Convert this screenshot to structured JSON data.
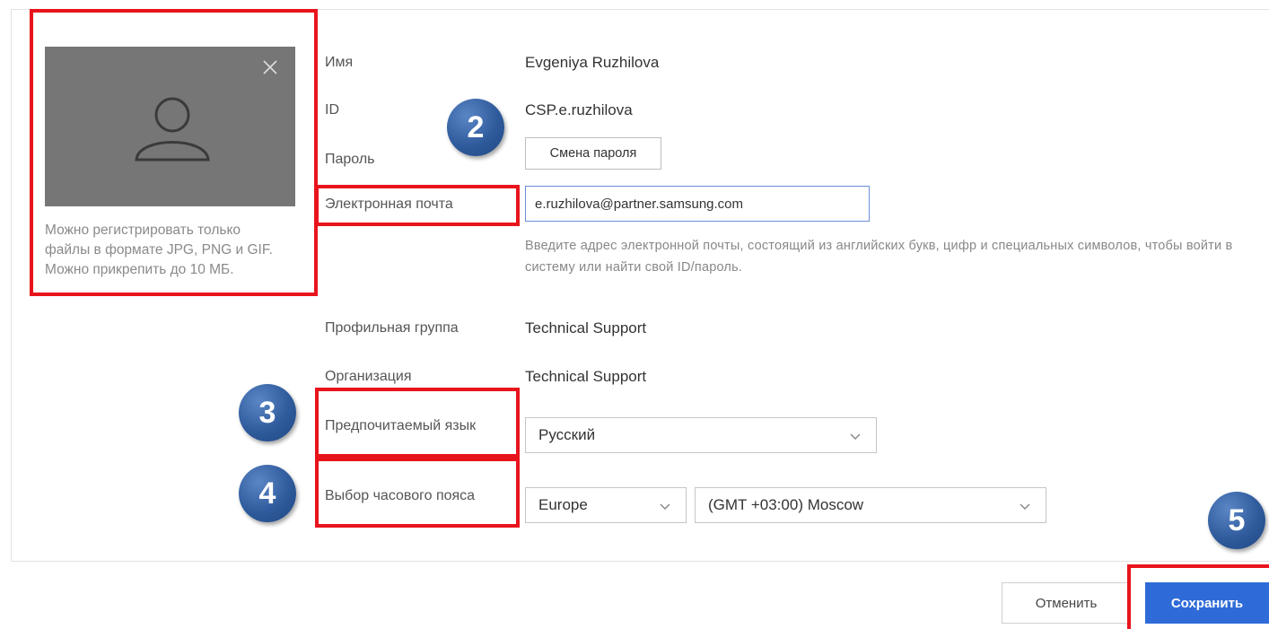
{
  "photo": {
    "help_text": "Можно регистрировать только файлы в формате JPG, PNG и GIF. Можно прикрепить до 10 МБ."
  },
  "fields": {
    "name_label": "Имя",
    "name_value": "Evgeniya Ruzhilova",
    "id_label": "ID",
    "id_value": "CSP.e.ruzhilova",
    "password_label": "Пароль",
    "password_button": "Смена пароля",
    "email_label": "Электронная почта",
    "email_value": "e.ruzhilova@partner.samsung.com",
    "email_help": "Введите адрес электронной почты, состоящий из английских букв, цифр и специальных символов, чтобы войти в систему или найти свой ID/пароль.",
    "profile_group_label": "Профильная группа",
    "profile_group_value": "Technical Support",
    "organization_label": "Организация",
    "organization_value": "Technical Support",
    "language_label": "Предпочитаемый язык",
    "language_value": "Русский",
    "timezone_label": "Выбор часового пояса",
    "timezone_region": "Europe",
    "timezone_value": "(GMT +03:00) Moscow"
  },
  "badges": [
    "2",
    "3",
    "4",
    "5"
  ],
  "buttons": {
    "cancel": "Отменить",
    "save": "Сохранить"
  },
  "colors": {
    "highlight": "#e8141c",
    "badge": "#2f5b9c",
    "primary": "#2f6bd8"
  }
}
